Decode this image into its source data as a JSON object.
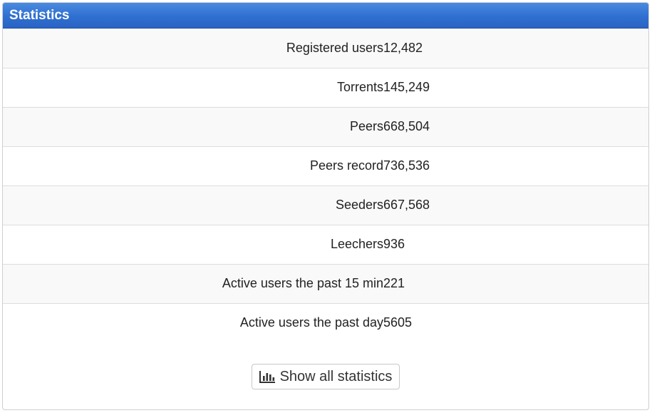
{
  "panel": {
    "title": "Statistics"
  },
  "stats": [
    {
      "label": "Registered users",
      "value": "12,482"
    },
    {
      "label": "Torrents",
      "value": "145,249"
    },
    {
      "label": "Peers",
      "value": "668,504"
    },
    {
      "label": "Peers record",
      "value": "736,536"
    },
    {
      "label": "Seeders",
      "value": "667,568"
    },
    {
      "label": "Leechers",
      "value": "936"
    },
    {
      "label": "Active users the past 15 min",
      "value": "221"
    },
    {
      "label": "Active users the past day",
      "value": "5605"
    }
  ],
  "footer": {
    "button_label": "Show all statistics",
    "button_icon": "bar-chart-icon"
  },
  "colors": {
    "header": "#2f6fd0",
    "stripe": "#f9f9f9"
  }
}
